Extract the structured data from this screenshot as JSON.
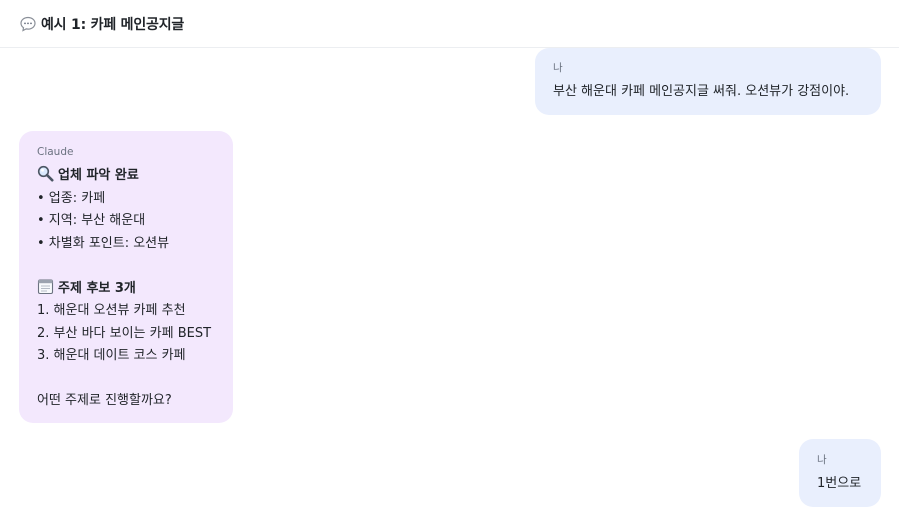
{
  "header": {
    "title": "예시 1: 카페 메인공지글",
    "icon": "speech-bubble-icon"
  },
  "messages": [
    {
      "role": "user",
      "sender": "나",
      "text": "부산 해운대 카페 메인공지글 써줘. 오션뷰가 강점이야."
    },
    {
      "role": "assistant",
      "sender": "Claude",
      "section1_title": "업체 파악 완료",
      "section1_icon": "magnifier-icon",
      "section1_items": [
        "• 업종: 카페",
        "• 지역: 부산 해운대",
        "• 차별화 포인트: 오션뷰"
      ],
      "section2_title": "주제 후보 3개",
      "section2_icon": "notepad-icon",
      "section2_items": [
        "1. 해운대 오션뷰 카페 추천",
        "2. 부산 바다 보이는 카페 BEST",
        "3. 해운대 데이트 코스 카페"
      ],
      "question": "어떤 주제로 진행할까요?"
    },
    {
      "role": "user",
      "sender": "나",
      "text": "1번으로"
    }
  ],
  "colors": {
    "user_bubble": "#e9effd",
    "assistant_bubble": "#f3e8fd",
    "divider": "#eceef1"
  }
}
